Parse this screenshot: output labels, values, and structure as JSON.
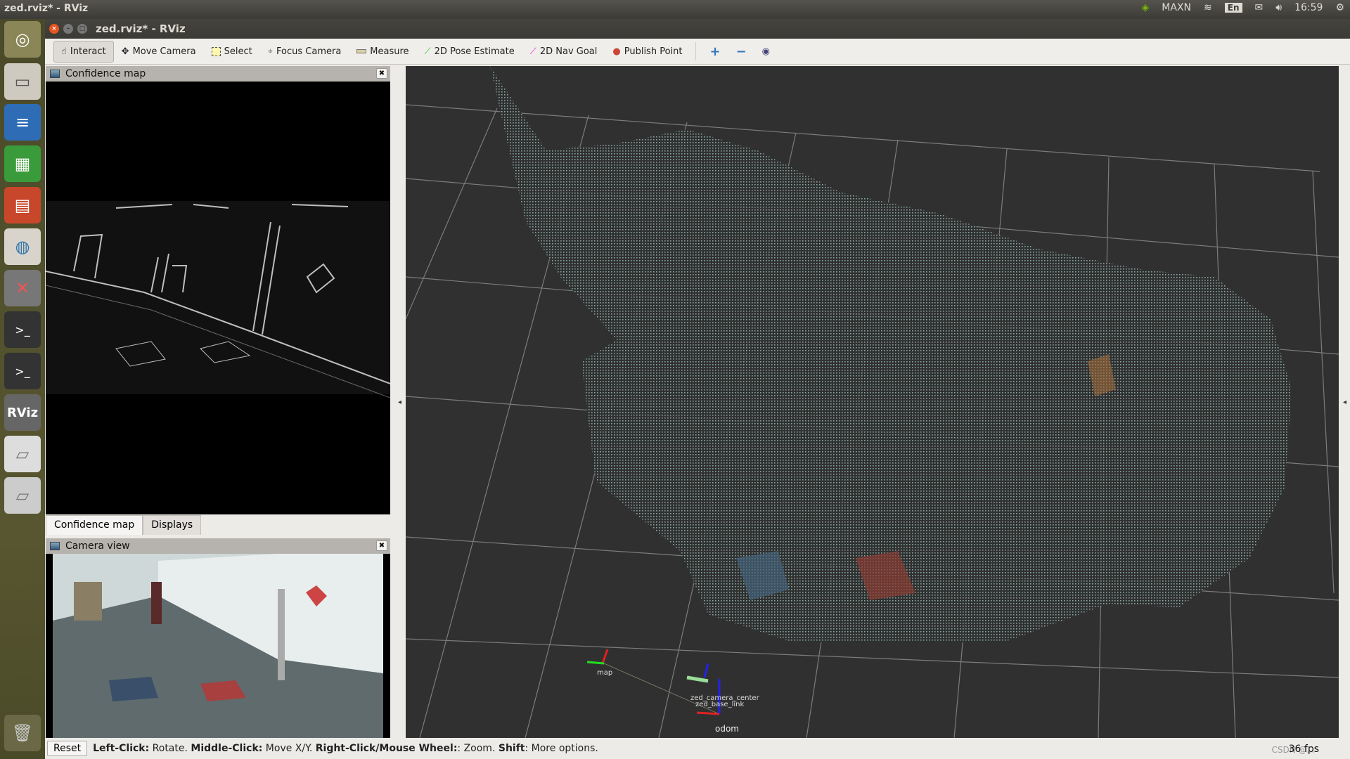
{
  "top_panel": {
    "title": "zed.rviz* - RViz",
    "power_mode": "MAXN",
    "keyboard": "En",
    "clock": "16:59"
  },
  "launcher": {
    "items": [
      "dash-icon",
      "files-icon",
      "writer-icon",
      "calc-icon",
      "impress-icon",
      "software-center-icon",
      "system-settings-icon",
      "terminal-icon",
      "terminal-icon",
      "rviz-icon",
      "drive-icon",
      "drive-icon",
      "trash-icon"
    ],
    "rviz_label": "RViz"
  },
  "window": {
    "title": "zed.rviz* - RViz"
  },
  "toolbar": {
    "tools": [
      {
        "label": "Interact",
        "icon": "hand-icon"
      },
      {
        "label": "Move Camera",
        "icon": "move-icon"
      },
      {
        "label": "Select",
        "icon": "select-icon"
      },
      {
        "label": "Focus Camera",
        "icon": "crosshair-icon"
      },
      {
        "label": "Measure",
        "icon": "ruler-icon"
      },
      {
        "label": "2D Pose Estimate",
        "icon": "green-arrow-icon"
      },
      {
        "label": "2D Nav Goal",
        "icon": "pink-arrow-icon"
      },
      {
        "label": "Publish Point",
        "icon": "pin-icon"
      }
    ],
    "active": "Interact"
  },
  "panels": {
    "confidence_title": "Confidence map",
    "tabs": [
      "Confidence map",
      "Displays"
    ],
    "camera_title": "Camera view"
  },
  "view3d": {
    "frames": [
      "map",
      "zed_camera_center",
      "zed_base_link",
      "odom"
    ]
  },
  "status": {
    "reset": "Reset",
    "hints": [
      {
        "b": "Left-Click:",
        "t": " Rotate. "
      },
      {
        "b": "Middle-Click:",
        "t": " Move X/Y. "
      },
      {
        "b": "Right-Click/Mouse Wheel:",
        "t": ": Zoom. "
      },
      {
        "b": "Shift",
        "t": ": More options."
      }
    ],
    "fps": "36 fps",
    "watermark": "CSDN @..."
  },
  "colors": {
    "grid": "#a0a0a4",
    "cloud": "#8fb3ad",
    "background3d": "#303030"
  }
}
